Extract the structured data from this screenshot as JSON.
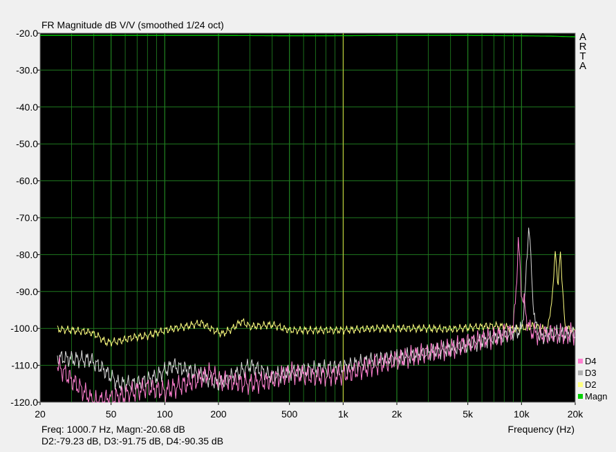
{
  "chart_data": {
    "type": "line",
    "title": "FR Magnitude dB V/V (smoothed 1/24 oct)",
    "xlabel": "Frequency (Hz)",
    "ylabel": "",
    "x_scale": "log",
    "xlim": [
      20,
      20000
    ],
    "ylim": [
      -120,
      -20
    ],
    "grid": true,
    "xticks": [
      20,
      50,
      100,
      200,
      500,
      1000,
      2000,
      5000,
      10000,
      20000
    ],
    "xtick_labels": [
      "20",
      "50",
      "100",
      "200",
      "500",
      "1k",
      "2k",
      "5k",
      "10k",
      "20k"
    ],
    "yticks": [
      -20,
      -30,
      -40,
      -50,
      -60,
      -70,
      -80,
      -90,
      -100,
      -110,
      -120
    ],
    "ytick_labels": [
      "-20.0",
      "-30.0",
      "-40.0",
      "-50.0",
      "-60.0",
      "-70.0",
      "-80.0",
      "-90.0",
      "-100.0",
      "-110.0",
      "-120.0"
    ],
    "cursor_x": 1000.7,
    "legend_position": "bottom-right",
    "series": [
      {
        "name": "Magn",
        "color": "#00d000",
        "x": [
          20,
          25,
          50,
          100,
          200,
          500,
          1000,
          2000,
          5000,
          10000,
          15000,
          20000
        ],
        "y": [
          -20.6,
          -20.6,
          -20.6,
          -20.6,
          -20.6,
          -20.7,
          -20.68,
          -20.6,
          -20.6,
          -20.7,
          -20.8,
          -21.0
        ]
      },
      {
        "name": "D2",
        "color": "#ffff80",
        "x": [
          25,
          30,
          38,
          42,
          47,
          55,
          65,
          80,
          100,
          130,
          160,
          180,
          210,
          240,
          270,
          300,
          400,
          500,
          700,
          1000,
          1500,
          2000,
          3000,
          4000,
          5000,
          6000,
          7000,
          8000,
          9000,
          10000,
          11000,
          12000,
          13000,
          14000,
          15000,
          15500,
          16000,
          16500,
          17000,
          17500,
          18000,
          19000,
          20000
        ],
        "y": [
          -100.2,
          -100.5,
          -101,
          -102,
          -103.8,
          -103.5,
          -102.5,
          -102,
          -100.5,
          -99.5,
          -98.5,
          -100,
          -101.5,
          -100,
          -98,
          -99.5,
          -99,
          -100.5,
          -100.5,
          -100.5,
          -100,
          -100,
          -100,
          -100.2,
          -99.8,
          -99.5,
          -99.3,
          -99.5,
          -100.3,
          -100,
          -99.5,
          -99.2,
          -100,
          -100.5,
          -90,
          -77.5,
          -90,
          -78,
          -90,
          -98.8,
          -100,
          -100.3,
          -100.8
        ]
      },
      {
        "name": "D3",
        "color": "#d8d8d8",
        "x": [
          25,
          30,
          38,
          45,
          55,
          70,
          90,
          110,
          150,
          200,
          260,
          300,
          400,
          500,
          700,
          1000,
          1500,
          2000,
          3000,
          4000,
          5000,
          6000,
          7000,
          8000,
          9000,
          10000,
          10500,
          11000,
          11500,
          12000,
          12500,
          13000,
          14000,
          15000,
          17000,
          20000
        ],
        "y": [
          -107.8,
          -108.3,
          -108.5,
          -111,
          -115,
          -115,
          -113,
          -110,
          -112,
          -115,
          -112,
          -110,
          -113,
          -112,
          -111,
          -110.5,
          -108.5,
          -108,
          -106.5,
          -105.5,
          -104.5,
          -103.5,
          -102.5,
          -102,
          -101,
          -100.5,
          -90,
          -70.5,
          -90,
          -99.5,
          -101.5,
          -102.5,
          -101.5,
          -101.5,
          -101.5,
          -101.5
        ]
      },
      {
        "name": "D4",
        "color": "#ff80d0",
        "x": [
          25,
          30,
          35,
          40,
          50,
          60,
          80,
          100,
          150,
          180,
          200,
          300,
          400,
          500,
          700,
          1000,
          1500,
          2000,
          3000,
          4000,
          5000,
          6000,
          7000,
          8000,
          8500,
          9000,
          9300,
          9600,
          10000,
          11000,
          12000,
          15000,
          20000
        ],
        "y": [
          -110,
          -114,
          -117,
          -120,
          -119,
          -118,
          -116,
          -117,
          -114,
          -112,
          -114,
          -115,
          -114,
          -112,
          -113,
          -112.5,
          -110,
          -108.5,
          -106.5,
          -105.5,
          -104,
          -103,
          -102.5,
          -101.5,
          -101,
          -100.5,
          -90,
          -76.5,
          -90,
          -100,
          -101.5,
          -101.5,
          -101.5
        ]
      }
    ]
  },
  "readout": {
    "line1": "Freq: 1000.7 Hz, Magn:-20.68 dB",
    "line2": "D2:-79.23 dB, D3:-91.75 dB, D4:-90.35 dB"
  },
  "brand": [
    "A",
    "R",
    "T",
    "A"
  ],
  "legend": [
    {
      "label": "D4",
      "color": "#ff80d0"
    },
    {
      "label": "D3",
      "color": "#b0b0b0"
    },
    {
      "label": "D2",
      "color": "#ffff80"
    },
    {
      "label": "Magn",
      "color": "#00d000"
    }
  ]
}
